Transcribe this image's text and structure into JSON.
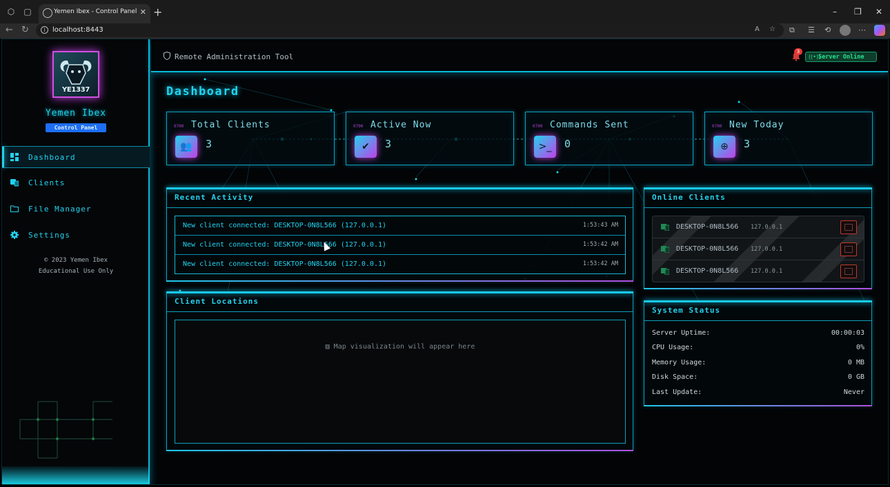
{
  "browser": {
    "tab_title": "Yemen Ibex - Control Panel",
    "url": "localhost:8443"
  },
  "sidebar": {
    "avatar_text": "YE1337",
    "brand_name": "Yemen Ibex",
    "brand_badge": "Control Panel",
    "items": [
      {
        "label": "Dashboard",
        "icon": "dashboard-icon",
        "active": true
      },
      {
        "label": "Clients",
        "icon": "clients-icon",
        "active": false
      },
      {
        "label": "File Manager",
        "icon": "folder-icon",
        "active": false
      },
      {
        "label": "Settings",
        "icon": "gear-icon",
        "active": false
      }
    ],
    "footer_line1": "© 2023 Yemen Ibex",
    "footer_line2": "Educational Use Only"
  },
  "header": {
    "title": "Remote Administration Tool",
    "notification_count": "3",
    "server_status": "Server Online"
  },
  "main": {
    "page_title": "Dashboard",
    "stats": [
      {
        "label": "Total Clients",
        "value": "3",
        "icon": "users-icon",
        "tag": "0700"
      },
      {
        "label": "Active Now",
        "value": "3",
        "icon": "user-check-icon",
        "tag": "0700"
      },
      {
        "label": "Commands Sent",
        "value": "0",
        "icon": "terminal-icon",
        "tag": "0700"
      },
      {
        "label": "New Today",
        "value": "3",
        "icon": "plus-circle-icon",
        "tag": "0700"
      }
    ],
    "recent_activity": {
      "title": "Recent Activity",
      "items": [
        {
          "text": "New client connected: DESKTOP-0N8L566 (127.0.0.1)",
          "time": "1:53:43 AM"
        },
        {
          "text": "New client connected: DESKTOP-0N8L566 (127.0.0.1)",
          "time": "1:53:42 AM"
        },
        {
          "text": "New client connected: DESKTOP-0N8L566 (127.0.0.1)",
          "time": "1:53:42 AM"
        }
      ]
    },
    "client_locations": {
      "title": "Client Locations",
      "placeholder": "Map visualization will appear here"
    },
    "online_clients": {
      "title": "Online Clients",
      "items": [
        {
          "name": "DESKTOP-0N8L566",
          "ip": "127.0.0.1"
        },
        {
          "name": "DESKTOP-0N8L566",
          "ip": "127.0.0.1"
        },
        {
          "name": "DESKTOP-0N8L566",
          "ip": "127.0.0.1"
        }
      ]
    },
    "system_status": {
      "title": "System Status",
      "rows": [
        {
          "label": "Server Uptime:",
          "value": "00:00:03"
        },
        {
          "label": "CPU Usage:",
          "value": "0%"
        },
        {
          "label": "Memory Usage:",
          "value": "0 MB"
        },
        {
          "label": "Disk Space:",
          "value": "0 GB"
        },
        {
          "label": "Last Update:",
          "value": "Never"
        }
      ]
    }
  }
}
